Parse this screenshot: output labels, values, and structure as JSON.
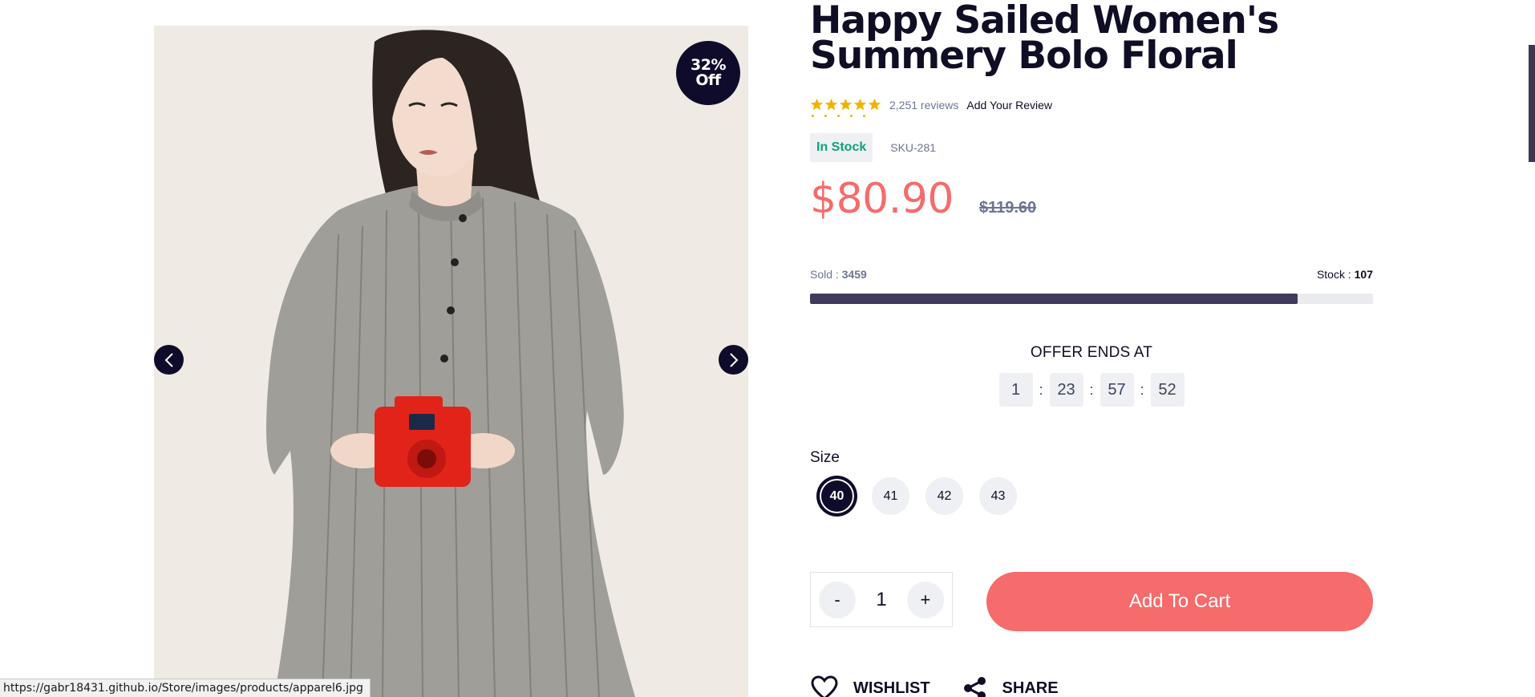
{
  "product": {
    "title": "Happy Sailed Women's Summery Bolo Floral",
    "discount_badge": {
      "line1": "32%",
      "line2": "Off"
    },
    "rating": {
      "stars": 5,
      "reviews_label": "2,251 reviews",
      "add_review_label": "Add Your Review"
    },
    "stock_status": "In Stock",
    "sku": "SKU-281",
    "price": "$80.90",
    "old_price": "$119.60",
    "sold": {
      "label": "Sold :",
      "value": "3459"
    },
    "stock": {
      "label": "Stock :",
      "value": "107"
    },
    "sold_progress": 0.866,
    "offer": {
      "label": "OFFER ENDS AT",
      "countdown": [
        "1",
        "23",
        "57",
        "52"
      ]
    },
    "size": {
      "label": "Size",
      "options": [
        "40",
        "41",
        "42",
        "43"
      ],
      "selected": "40"
    },
    "quantity": {
      "minus": "-",
      "value": "1",
      "plus": "+"
    },
    "add_to_cart_label": "Add To Cart",
    "wishlist_label": "WISHLIST",
    "share_label": "SHARE"
  },
  "browser": {
    "status_url": "https://gabr18431.github.io/Store/images/products/apparel6.jpg"
  },
  "colors": {
    "accent": "#f66b6b",
    "dark": "#0f0b2a",
    "stock_green": "#0fa37a",
    "star": "#f0b400"
  },
  "icons": {
    "prev": "chevron-left-icon",
    "next": "chevron-right-icon",
    "wishlist": "heart-icon",
    "share": "share-icon"
  }
}
